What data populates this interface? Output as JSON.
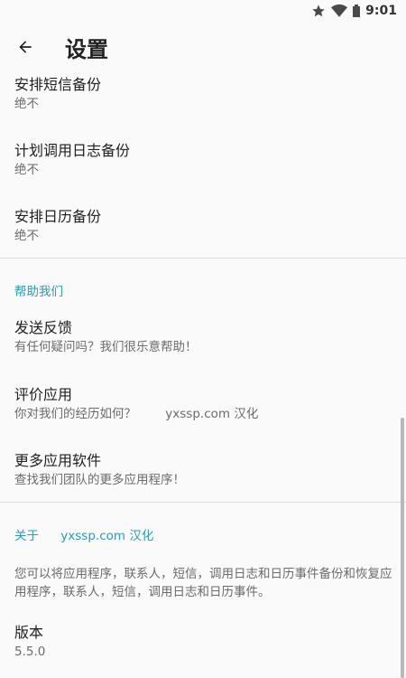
{
  "status_bar": {
    "time": "9:01",
    "icons": [
      "star-icon",
      "wifi-icon",
      "battery-icon"
    ]
  },
  "app_bar": {
    "title": "设置",
    "back_icon": "arrow-left-icon"
  },
  "backup_prefs": [
    {
      "title": "安排短信备份",
      "summary": "绝不"
    },
    {
      "title": "计划调用日志备份",
      "summary": "绝不"
    },
    {
      "title": "安排日历备份",
      "summary": "绝不"
    }
  ],
  "help": {
    "header": "帮助我们",
    "items": [
      {
        "title": "发送反馈",
        "summary": "有任何疑问吗？我们很乐意帮助！"
      },
      {
        "title": "评价应用",
        "summary": "你对我们的经历如何？",
        "watermark": "yxssp.com 汉化"
      },
      {
        "title": "更多应用软件",
        "summary": "查找我们团队的更多应用程序！"
      }
    ]
  },
  "about": {
    "header": "关于",
    "header_watermark": "yxssp.com 汉化",
    "description": "您可以将应用程序，联系人，短信，调用日志和日历事件备份和恢复应用程序，联系人，短信，调用日志和日历事件。",
    "version_title": "版本",
    "version_value": "5.5.0"
  },
  "colors": {
    "accent": "#2a9bb8",
    "background": "#fafafa",
    "text": "#212121",
    "secondary_text": "#6b6b6b"
  }
}
